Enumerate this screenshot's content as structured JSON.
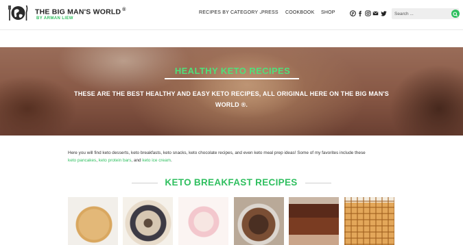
{
  "brand": {
    "title": "THE BIG MAN'S WORLD",
    "registered": "®",
    "subtitle": "BY ARMAN LIEW"
  },
  "nav": {
    "items": [
      {
        "label": "RECIPES BY CATEGORY",
        "has_dropdown": true
      },
      {
        "label": "PRESS"
      },
      {
        "label": "COOKBOOK"
      },
      {
        "label": "SHOP"
      }
    ],
    "social_icons": [
      "pinterest-icon",
      "facebook-icon",
      "instagram-icon",
      "email-icon",
      "twitter-icon"
    ]
  },
  "search": {
    "placeholder": "Search ..."
  },
  "hero": {
    "title": "HEALTHY KETO RECIPES",
    "subtitle": "THESE ARE THE BEST HEALTHY AND EASY KETO RECIPES, ALL ORIGINAL HERE ON THE BIG MAN'S WORLD ®."
  },
  "intro": {
    "text": "Here you will find keto desserts, keto breakfasts, keto snacks, keto chocolate recipes, and even keto meal prep ideas! Some of my favorites include these",
    "links": [
      "keto pancakes",
      "keto protein bars",
      "keto ice cream"
    ],
    "sep1": ", ",
    "sep2": ", and ",
    "end": "."
  },
  "section": {
    "title": "KETO BREAKFAST RECIPES"
  },
  "colors": {
    "accent": "#2fbf5f",
    "hero_title": "#4fe07a"
  }
}
